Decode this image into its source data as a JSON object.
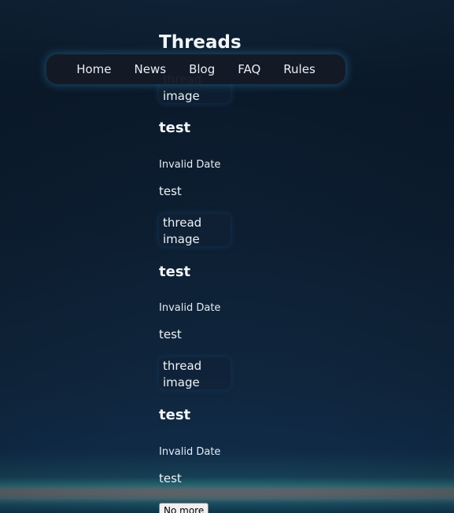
{
  "page": {
    "title": "Threads"
  },
  "nav": {
    "items": [
      {
        "label": "Home"
      },
      {
        "label": "News"
      },
      {
        "label": "Blog"
      },
      {
        "label": "FAQ"
      },
      {
        "label": "Rules"
      }
    ]
  },
  "threads": [
    {
      "image_alt": "thread image",
      "title": "test",
      "date": "Invalid Date",
      "body": "test"
    },
    {
      "image_alt": "thread image",
      "title": "test",
      "date": "Invalid Date",
      "body": "test"
    },
    {
      "image_alt": "thread image",
      "title": "test",
      "date": "Invalid Date",
      "body": "test"
    }
  ],
  "pagination": {
    "more_label": "No more"
  },
  "colors": {
    "background_top": "#0f2438",
    "background_mid": "#0b1a2b",
    "navbar_bg": "#141a26",
    "navbar_glow": "#286e96",
    "text": "#eef3f7"
  }
}
